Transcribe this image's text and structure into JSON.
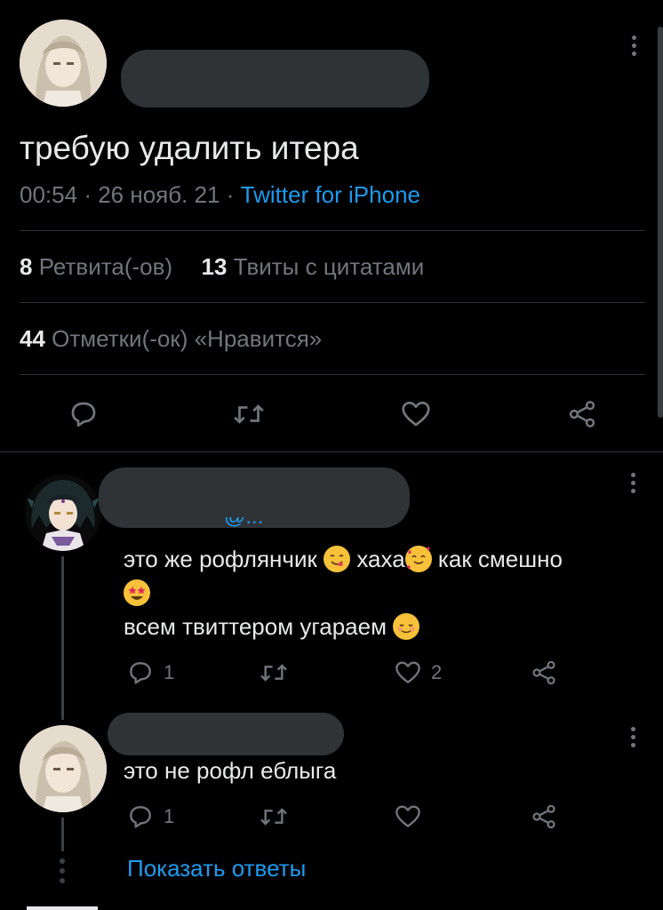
{
  "tweet": {
    "text": "требую удалить итера",
    "time": "00:54",
    "sep1": "·",
    "date": "26 нояб. 21",
    "sep2": "·",
    "source": "Twitter for iPhone",
    "retweets_count": "8",
    "retweets_label": "Ретвита(-ов)",
    "quotes_count": "13",
    "quotes_label": "Твиты с цитатами",
    "likes_count": "44",
    "likes_label": "Отметки(-ок) «Нравится»"
  },
  "replies": [
    {
      "handle_fragment": "@...",
      "line1": "это же рофлянчик",
      "word_haha": "хаха",
      "line1_end": "как смешно",
      "line2": "всем твиттером угараем",
      "reply_count": "1",
      "retweet_count": "",
      "like_count": "2"
    },
    {
      "text": "это не рофл еблыга",
      "reply_count": "1",
      "retweet_count": "",
      "like_count": ""
    }
  ],
  "show_replies": "Показать ответы",
  "icons": {
    "reply": "reply-icon",
    "retweet": "retweet-icon",
    "like": "heart-icon",
    "share": "share-icon",
    "more": "more-vertical-icon"
  },
  "colors": {
    "background": "#000000",
    "text": "#e7e9ea",
    "muted": "#71767b",
    "link": "#1d9bf0",
    "divider": "#2f3336"
  }
}
